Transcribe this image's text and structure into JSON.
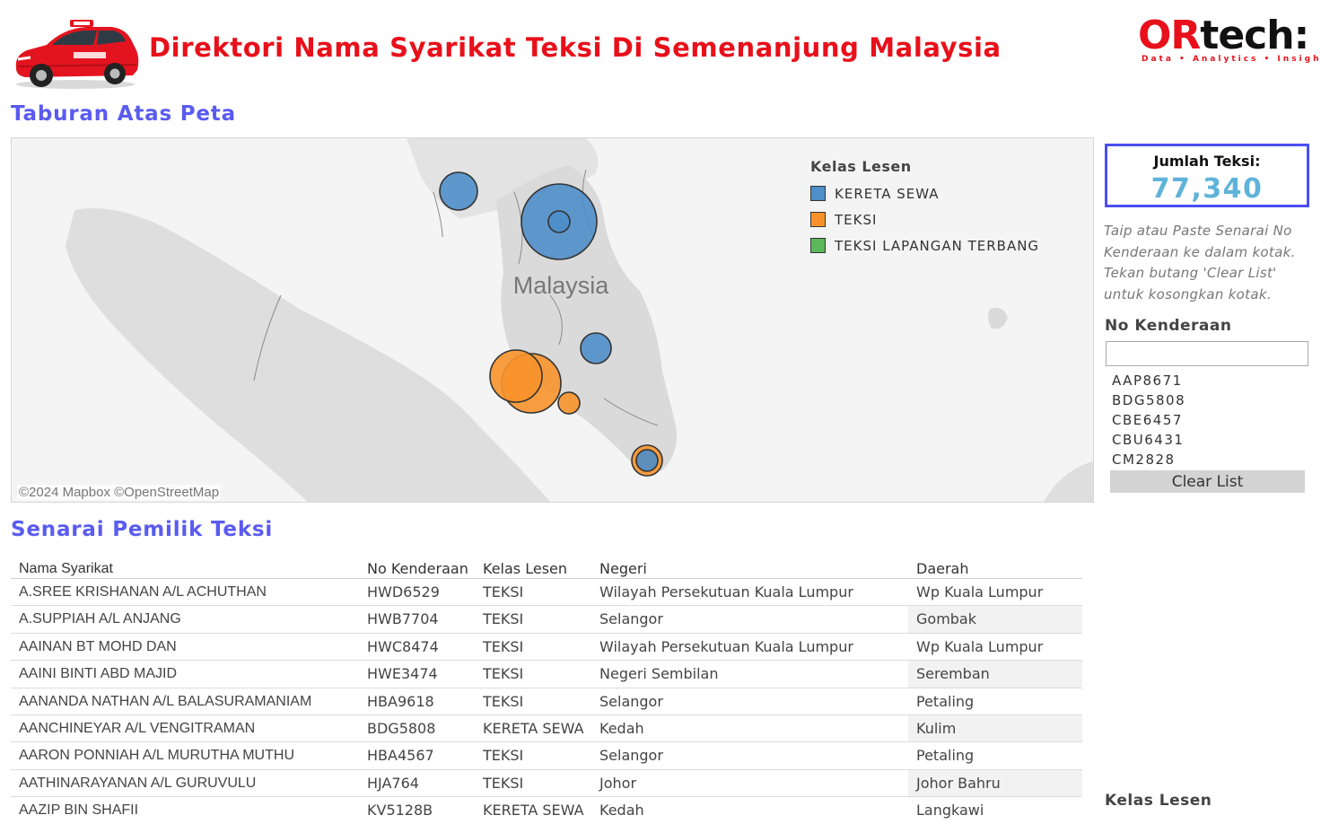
{
  "header": {
    "title": "Direktori Nama Syarikat Teksi Di Semenanjung Malaysia",
    "logo_main_a": "OR",
    "logo_main_b": "tech:",
    "logo_tagline": "Data • Analytics • Insight"
  },
  "map_section": {
    "heading": "Taburan Atas Peta",
    "place_label": "Malaysia",
    "attribution": "©2024 Mapbox ©OpenStreetMap",
    "legend": {
      "title": "Kelas Lesen",
      "items": [
        {
          "label": "KERETA SEWA",
          "color": "#4e8ec9"
        },
        {
          "label": "TEKSI",
          "color": "#f7922b"
        },
        {
          "label": "TEKSI LAPANGAN TERBANG",
          "color": "#5bb85a"
        }
      ]
    }
  },
  "side_panel": {
    "total_label": "Jumlah Teksi:",
    "total_value": "77,340",
    "instructions": "Taip atau Paste Senarai No Kenderaan ke dalam kotak. Tekan butang 'Clear List' untuk kosongkan kotak.",
    "filter_title": "No Kenderaan",
    "filter_value": "",
    "filter_items": [
      "AAP8671",
      "BDG5808",
      "CBE6457",
      "CBU6431",
      "CM2828"
    ],
    "clear_button": "Clear List",
    "legend_title": "Kelas Lesen"
  },
  "list_section": {
    "heading": "Senarai Pemilik Teksi",
    "columns": [
      "Nama Syarikat",
      "No Kenderaan",
      "Kelas Lesen",
      "Negeri",
      "Daerah"
    ],
    "rows": [
      [
        "A.SREE KRISHANAN A/L ACHUTHAN",
        "HWD6529",
        "TEKSI",
        "Wilayah Persekutuan Kuala Lumpur",
        "Wp Kuala Lumpur"
      ],
      [
        "A.SUPPIAH A/L ANJANG",
        "HWB7704",
        "TEKSI",
        "Selangor",
        "Gombak"
      ],
      [
        "AAINAN BT MOHD DAN",
        "HWC8474",
        "TEKSI",
        "Wilayah Persekutuan Kuala Lumpur",
        "Wp Kuala Lumpur"
      ],
      [
        "AAINI BINTI ABD MAJID",
        "HWE3474",
        "TEKSI",
        "Negeri Sembilan",
        "Seremban"
      ],
      [
        "AANANDA NATHAN A/L BALASURAMANIAM",
        "HBA9618",
        "TEKSI",
        "Selangor",
        "Petaling"
      ],
      [
        "AANCHINEYAR A/L VENGITRAMAN",
        "BDG5808",
        "KERETA SEWA",
        "Kedah",
        "Kulim"
      ],
      [
        "AARON PONNIAH A/L MURUTHA MUTHU",
        "HBA4567",
        "TEKSI",
        "Selangor",
        "Petaling"
      ],
      [
        "AATHINARAYANAN A/L GURUVULU",
        "HJA764",
        "TEKSI",
        "Johor",
        "Johor Bahru"
      ],
      [
        "AAZIP BIN SHAFII",
        "KV5128B",
        "KERETA SEWA",
        "Kedah",
        "Langkawi"
      ]
    ]
  }
}
